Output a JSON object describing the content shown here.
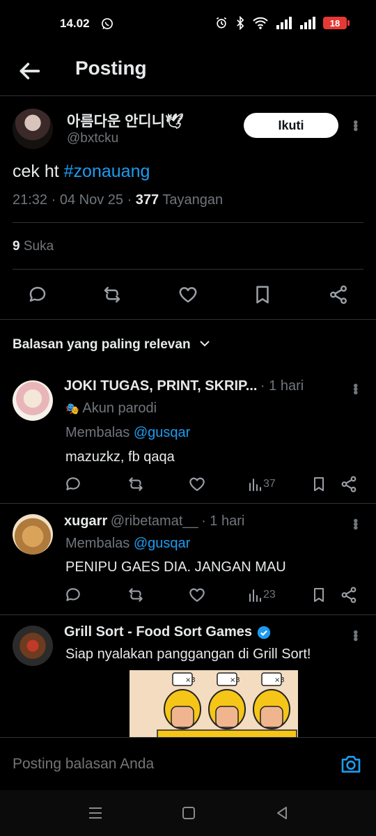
{
  "status": {
    "time": "14.02",
    "battery": "18"
  },
  "header": {
    "title": "Posting"
  },
  "post": {
    "author_name": "아름다운 안디니🕊",
    "author_handle": "@bxtcku",
    "follow_label": "Ikuti",
    "text": "cek ht",
    "hashtag": "#zonauang",
    "time": "21:32",
    "date": "04 Nov 25",
    "views": "377",
    "views_label": "Tayangan",
    "likes_count": "9",
    "likes_label": "Suka"
  },
  "sort_label": "Balasan yang paling relevan",
  "replies": [
    {
      "name": "JOKI TUGAS, PRINT, SKRIP...",
      "time": "· 1 hari",
      "badge": "Akun parodi",
      "replying_label": "Membalas",
      "replying_to": "@gusqar",
      "text": "mazuzkz, fb qaqa",
      "views": "37"
    },
    {
      "name": "xugarr",
      "handle": "@ribetamat__",
      "time": "· 1 hari",
      "replying_label": "Membalas",
      "replying_to": "@gusqar",
      "text": "PENIPU GAES DIA. JANGAN MAU",
      "views": "23"
    },
    {
      "name": "Grill Sort - Food Sort Games",
      "text": "Siap nyalakan panggangan di Grill Sort!"
    }
  ],
  "ad_badges": [
    "×3",
    "×3",
    "×3"
  ],
  "reply_box": {
    "placeholder": "Posting balasan Anda"
  },
  "colors": {
    "accent": "#1d9bf0",
    "background": "#000000",
    "battery": "#e53935"
  }
}
